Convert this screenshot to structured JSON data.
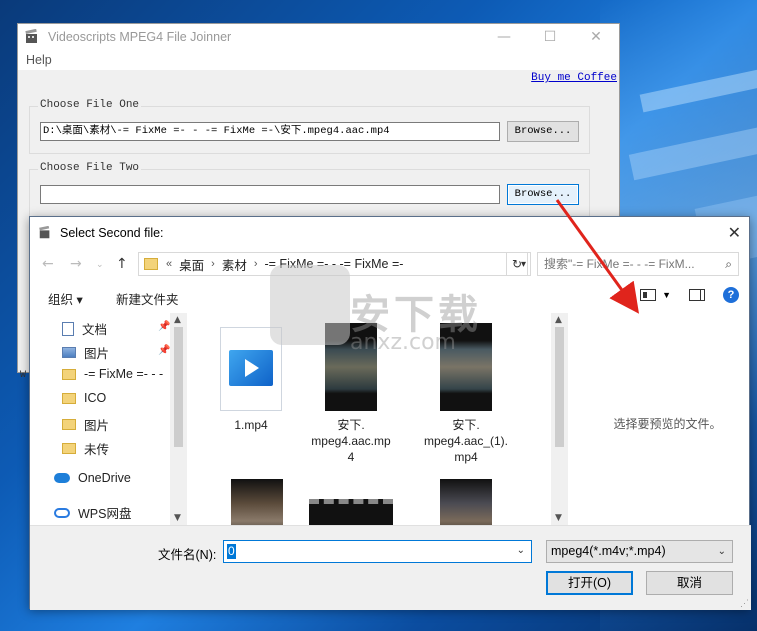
{
  "app": {
    "title": "Videoscripts MPEG4 File Joinner",
    "menu_help": "Help",
    "buy_coffee": "Buy me Coffee",
    "group1_label": "Choose File One",
    "group1_path": "D:\\桌面\\素材\\-= FixMe =- - -= FixMe =-\\安下.mpeg4.aac.mp4",
    "group1_browse": "Browse...",
    "group2_label": "Choose File Two",
    "group2_path": "",
    "group2_browse": "Browse...",
    "stub": "W"
  },
  "dialog": {
    "title": "Select Second file:",
    "address": {
      "chevrons": "«",
      "segments": [
        "桌面",
        "素材",
        "-= FixMe =- - -= FixMe =-"
      ]
    },
    "search_placeholder": "搜索\"-= FixMe =- - -= FixM...",
    "organize": "组织 ▾",
    "new_folder": "新建文件夹",
    "nav_items": [
      {
        "label": "文档",
        "icon": "document-icon",
        "pinned": true
      },
      {
        "label": "图片",
        "icon": "pictures-icon",
        "pinned": true
      },
      {
        "label": "-= FixMe =- - -",
        "icon": "folder-icon",
        "pinned": false
      },
      {
        "label": "ICO",
        "icon": "folder-icon",
        "pinned": false
      },
      {
        "label": "图片",
        "icon": "folder-icon",
        "pinned": false
      },
      {
        "label": "未传",
        "icon": "folder-icon",
        "pinned": false
      },
      {
        "label": "OneDrive",
        "icon": "onedrive-icon",
        "pinned": false
      },
      {
        "label": "WPS网盘",
        "icon": "wps-cloud-icon",
        "pinned": false
      }
    ],
    "files": [
      {
        "name": "1.mp4",
        "kind": "mp4-icon"
      },
      {
        "name": "安下.\nmpeg4.aac.mp\n4",
        "kind": "video-thumbnail"
      },
      {
        "name": "安下.\nmpeg4.aac_(1).\nmp4",
        "kind": "video-thumbnail"
      }
    ],
    "preview_text": "选择要预览的文件。",
    "filename_label": "文件名(N):",
    "filename_value": "0",
    "filetype": "mpeg4(*.m4v;*.mp4)",
    "open_button": "打开(O)",
    "cancel_button": "取消"
  },
  "watermark": {
    "text": "安下载",
    "sub": "anxz.com"
  },
  "colors": {
    "accent": "#0078d7",
    "arrow": "#e0241c",
    "link": "#0000cc"
  }
}
